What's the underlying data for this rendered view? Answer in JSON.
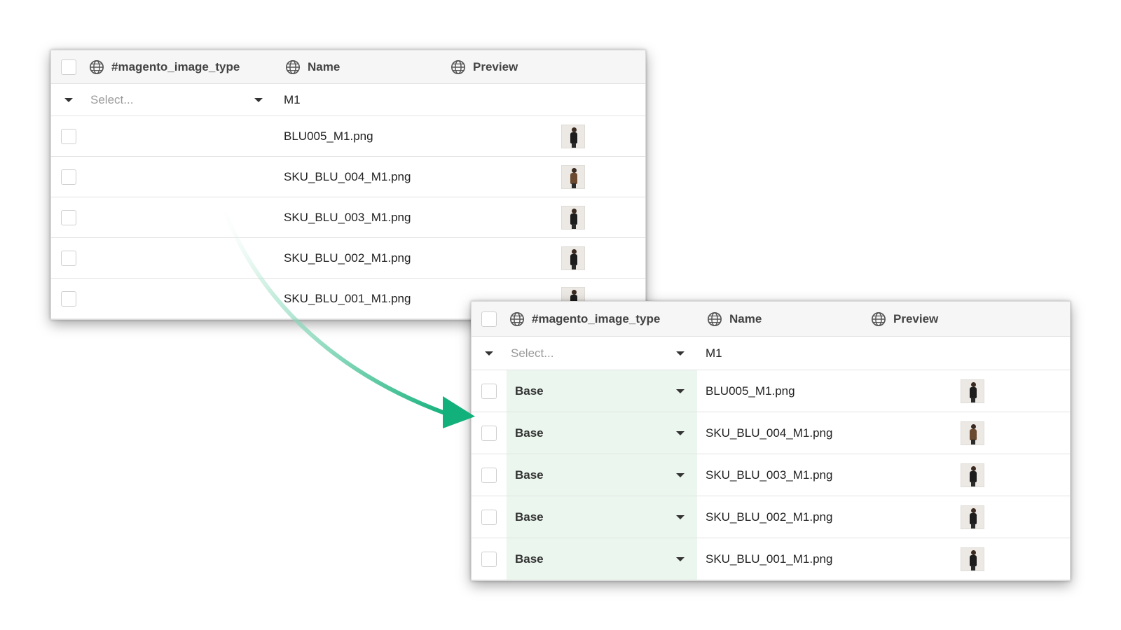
{
  "colors": {
    "arrow_start": "#ffffff",
    "arrow_end": "#12b07a",
    "type_cell_bg": "#eaf6ee"
  },
  "before_table": {
    "columns": {
      "type": "#magento_image_type",
      "name": "Name",
      "preview": "Preview"
    },
    "filter": {
      "type_placeholder": "Select...",
      "name_value": "M1"
    },
    "rows": [
      {
        "name": "BLU005_M1.png",
        "preview": "thumbnail"
      },
      {
        "name": "SKU_BLU_004_M1.png",
        "preview": "thumbnail"
      },
      {
        "name": "SKU_BLU_003_M1.png",
        "preview": "thumbnail"
      },
      {
        "name": "SKU_BLU_002_M1.png",
        "preview": "thumbnail"
      },
      {
        "name": "SKU_BLU_001_M1.png",
        "preview": "thumbnail"
      }
    ]
  },
  "after_table": {
    "columns": {
      "type": "#magento_image_type",
      "name": "Name",
      "preview": "Preview"
    },
    "filter": {
      "type_placeholder": "Select...",
      "name_value": "M1"
    },
    "rows": [
      {
        "type": "Base",
        "name": "BLU005_M1.png",
        "preview": "thumbnail"
      },
      {
        "type": "Base",
        "name": "SKU_BLU_004_M1.png",
        "preview": "thumbnail"
      },
      {
        "type": "Base",
        "name": "SKU_BLU_003_M1.png",
        "preview": "thumbnail"
      },
      {
        "type": "Base",
        "name": "SKU_BLU_002_M1.png",
        "preview": "thumbnail"
      },
      {
        "type": "Base",
        "name": "SKU_BLU_001_M1.png",
        "preview": "thumbnail"
      }
    ]
  },
  "icons": {
    "column_header": "globe-icon",
    "dropdown": "caret-down-icon"
  }
}
